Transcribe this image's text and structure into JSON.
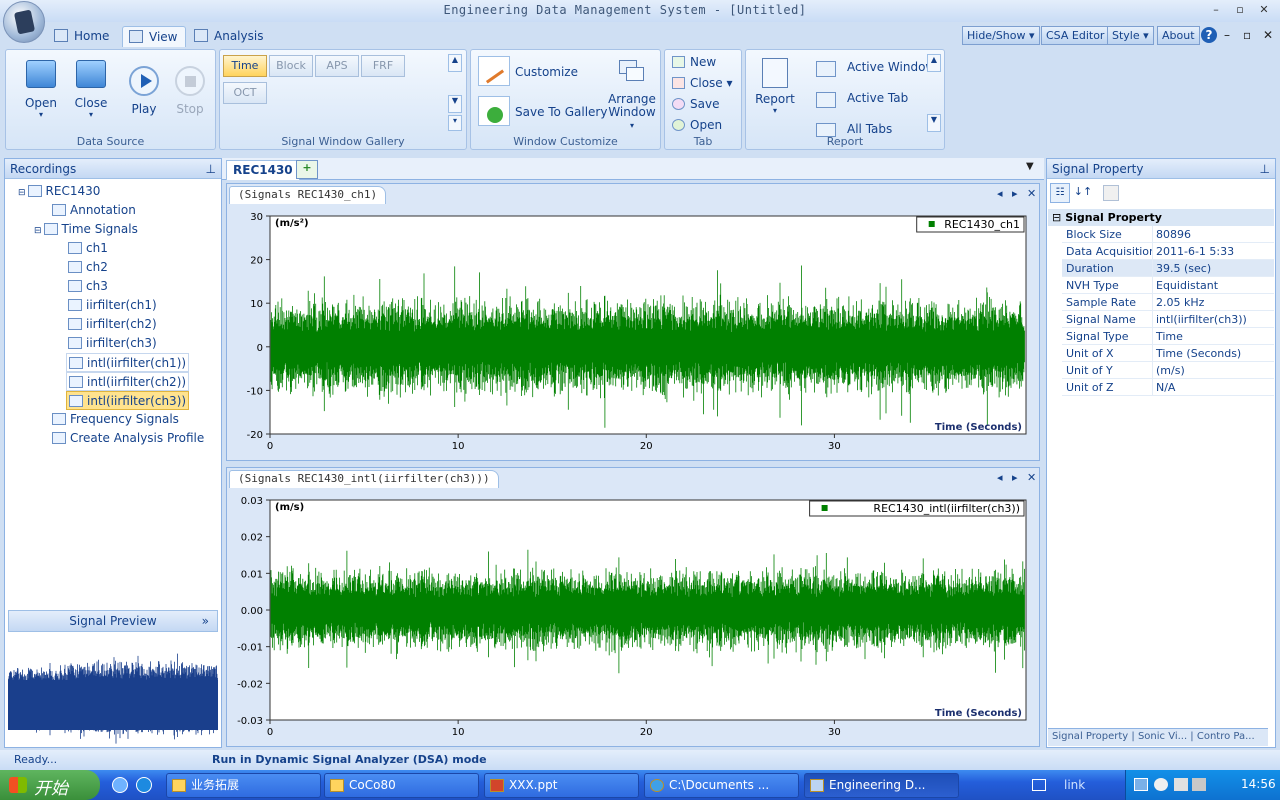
{
  "window": {
    "title": "Engineering Data Management System - [Untitled]"
  },
  "tabs": [
    {
      "label": "Home"
    },
    {
      "label": "View"
    },
    {
      "label": "Analysis"
    }
  ],
  "top_buttons": [
    {
      "label": "Hide/Show"
    },
    {
      "label": "CSA Editor"
    },
    {
      "label": "Style"
    },
    {
      "label": "About"
    }
  ],
  "ribbon": {
    "data_source": {
      "label": "Data Source",
      "open": "Open",
      "close": "Close",
      "play": "Play",
      "stop": "Stop"
    },
    "gallery": {
      "label": "Signal Window Gallery",
      "buttons": [
        "Time",
        "Block",
        "APS",
        "FRF",
        "OCT"
      ]
    },
    "window_customize": {
      "label": "Window Customize",
      "customize": "Customize",
      "save_to_gallery": "Save To Gallery",
      "arrange": "Arrange",
      "window": "Window"
    },
    "tab_group": {
      "label": "Tab",
      "new": "New",
      "close": "Close",
      "save": "Save",
      "open": "Open"
    },
    "report_group": {
      "label": "Report",
      "report": "Report",
      "active_window": "Active Window",
      "active_tab": "Active Tab",
      "all_tabs": "All Tabs"
    }
  },
  "recordings": {
    "header": "Recordings",
    "items": [
      {
        "label": "REC1430"
      },
      {
        "label": "Annotation"
      },
      {
        "label": "Time Signals"
      },
      {
        "label": "ch1"
      },
      {
        "label": "ch2"
      },
      {
        "label": "ch3"
      },
      {
        "label": "iirfilter(ch1)"
      },
      {
        "label": "iirfilter(ch2)"
      },
      {
        "label": "iirfilter(ch3)"
      },
      {
        "label": "intl(iirfilter(ch1))"
      },
      {
        "label": "intl(iirfilter(ch2))"
      },
      {
        "label": "intl(iirfilter(ch3))"
      },
      {
        "label": "Frequency Signals"
      },
      {
        "label": "Create Analysis Profile"
      }
    ],
    "preview_header": "Signal Preview"
  },
  "document": {
    "tab": "REC1430"
  },
  "plots": [
    {
      "tab": "(Signals REC1430_ch1)",
      "legend": "REC1430_ch1",
      "unit": "(m/s²)",
      "xlabel": "Time (Seconds)",
      "y_ticks": [
        "30",
        "20",
        "10",
        "0",
        "-10",
        "-20"
      ],
      "x_ticks": [
        "0",
        "10",
        "20",
        "30"
      ]
    },
    {
      "tab": "(Signals REC1430_intl(iirfilter(ch3)))",
      "legend": "REC1430_intl(iirfilter(ch3))",
      "unit": "(m/s)",
      "xlabel": "Time (Seconds)",
      "y_ticks": [
        "0.03",
        "0.02",
        "0.01",
        "0.00",
        "-0.01",
        "-0.02",
        "-0.03"
      ],
      "x_ticks": [
        "0",
        "10",
        "20",
        "30"
      ]
    }
  ],
  "chart_data": [
    {
      "type": "line",
      "x": [
        0,
        39.5
      ],
      "ylim": [
        -20,
        30
      ],
      "xlabel": "Time (Seconds)",
      "ylabel": "(m/s²)",
      "series": [
        {
          "name": "REC1430_ch1",
          "color": "#008000"
        }
      ],
      "legend": "top-right"
    },
    {
      "type": "line",
      "x": [
        0,
        39.5
      ],
      "ylim": [
        -0.03,
        0.03
      ],
      "xlabel": "Time (Seconds)",
      "ylabel": "(m/s)",
      "series": [
        {
          "name": "REC1430_intl(iirfilter(ch3))",
          "color": "#008000"
        }
      ],
      "legend": "top-right"
    }
  ],
  "signal_property": {
    "header": "Signal Property",
    "section": "Signal Property",
    "rows": [
      {
        "k": "Block Size",
        "v": "80896"
      },
      {
        "k": "Data Acquisition T",
        "v": "2011-6-1 5:33"
      },
      {
        "k": "Duration",
        "v": "39.5 (sec)"
      },
      {
        "k": "NVH Type",
        "v": "Equidistant"
      },
      {
        "k": "Sample Rate",
        "v": "2.05 kHz"
      },
      {
        "k": "Signal Name",
        "v": "intl(iirfilter(ch3))"
      },
      {
        "k": "Signal Type",
        "v": "Time"
      },
      {
        "k": "Unit of X",
        "v": "Time (Seconds)"
      },
      {
        "k": "Unit of Y",
        "v": "(m/s)"
      },
      {
        "k": "Unit of Z",
        "v": "N/A"
      }
    ]
  },
  "status": {
    "ready": "Ready...",
    "mode": "Run in Dynamic Signal Analyzer (DSA) mode"
  },
  "taskbar": {
    "start": "开始",
    "items": [
      {
        "label": "业务拓展"
      },
      {
        "label": "CoCo80"
      },
      {
        "label": "XXX.ppt"
      },
      {
        "label": "C:\\Documents ..."
      },
      {
        "label": "Engineering D..."
      }
    ],
    "link": "link",
    "clock": "14:56"
  },
  "colors": {
    "signal": "#008000",
    "preview": "#1a3f8c",
    "accent": "#15428b"
  }
}
